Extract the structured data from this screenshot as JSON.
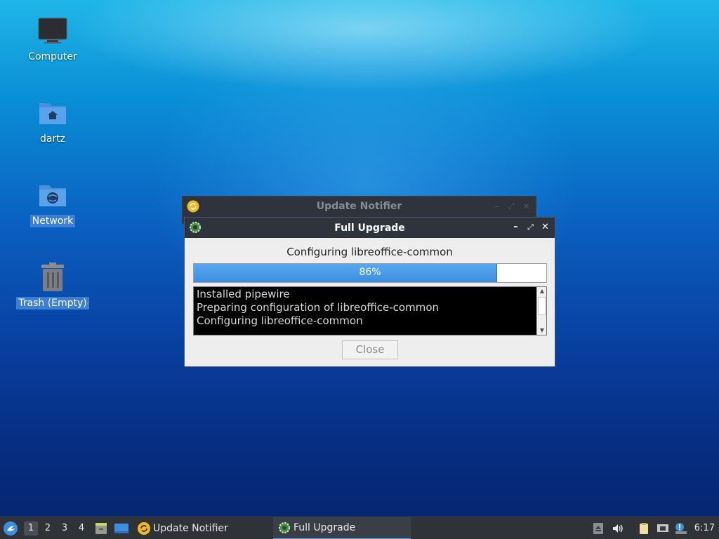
{
  "desktop": {
    "icons": [
      {
        "label": "Computer",
        "selected": false
      },
      {
        "label": "dartz",
        "selected": false
      },
      {
        "label": "Network",
        "selected": true
      },
      {
        "label": "Trash (Empty)",
        "selected": true
      }
    ]
  },
  "background_window": {
    "title": "Update Notifier"
  },
  "main_window": {
    "title": "Full Upgrade",
    "status": "Configuring libreoffice-common",
    "progress": {
      "value": 86,
      "label": "86%"
    },
    "log_lines": [
      "Installed pipewire",
      "Preparing configuration of libreoffice-common",
      "Configuring libreoffice-common"
    ],
    "close_label": "Close",
    "controls": {
      "minimize": "–",
      "maximize": "⤢",
      "close": "✕"
    }
  },
  "taskbar": {
    "workspaces": [
      "1",
      "2",
      "3",
      "4"
    ],
    "active_workspace": "1",
    "tasks": [
      {
        "label": "Update Notifier",
        "active": false
      },
      {
        "label": "Full Upgrade",
        "active": true
      }
    ],
    "clock": "6:17"
  },
  "colors": {
    "accent": "#3d7fd4",
    "titlebar": "#2f333b",
    "progress": "#3b8ee0",
    "taskbar": "#2f3237"
  }
}
